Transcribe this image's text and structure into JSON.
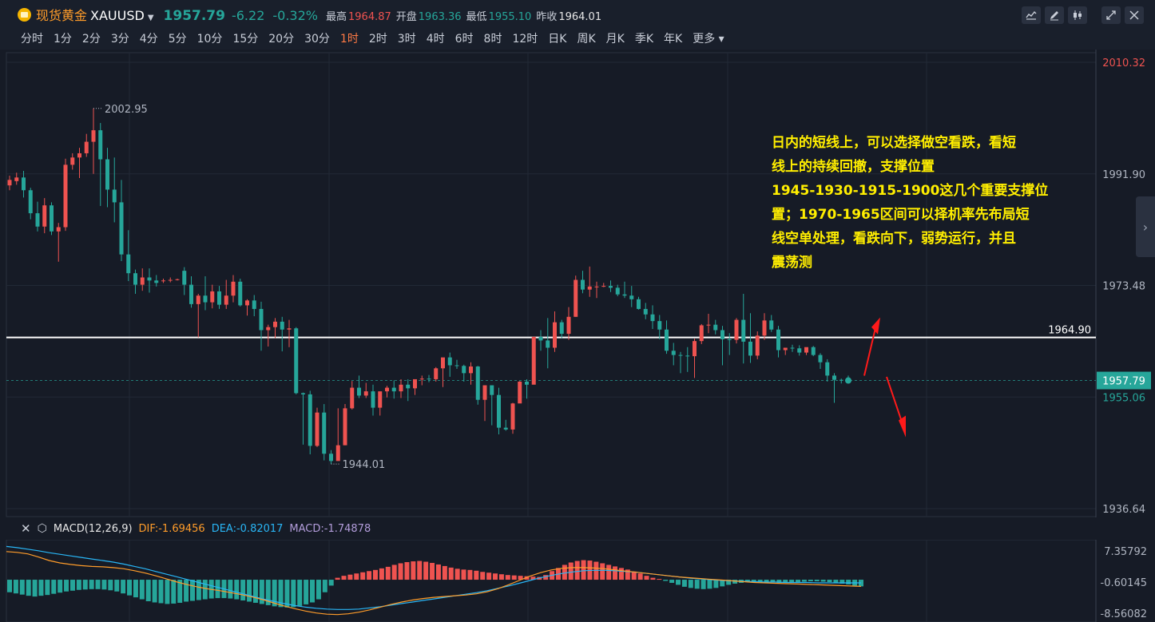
{
  "header": {
    "symbol_name": "现货黄金",
    "symbol_code": "XAUUSD",
    "price": "1957.79",
    "change": "-6.22",
    "change_pct": "-0.32%",
    "high_label": "最高",
    "high": "1964.87",
    "open_label": "开盘",
    "open": "1963.36",
    "low_label": "最低",
    "low": "1955.10",
    "prev_label": "昨收",
    "prev": "1964.01"
  },
  "timeframes": [
    "分时",
    "1分",
    "2分",
    "3分",
    "4分",
    "5分",
    "10分",
    "15分",
    "20分",
    "30分",
    "1时",
    "2时",
    "3时",
    "4时",
    "6时",
    "8时",
    "12时",
    "日K",
    "周K",
    "月K",
    "季K",
    "年K",
    "更多"
  ],
  "active_timeframe": "1时",
  "colors": {
    "up": "#ef5350",
    "down": "#26a69a",
    "annotation": "#ffee00",
    "dif": "#ff9c2a",
    "dea": "#29b6f6",
    "macd": "#b39ddb"
  },
  "annotation": {
    "lines": [
      "日内的短线上，可以选择做空看跌，看短",
      "线上的持续回撤，支撑位置",
      "1945-1930-1915-1900这几个重要支撑位",
      "置；1970-1965区间可以择机率先布局短",
      "线空单处理，看跌向下，弱势运行，并且",
      "震荡测"
    ]
  },
  "chart_data": [
    {
      "type": "candlestick",
      "title": "",
      "xlabel": "",
      "ylabel": "",
      "ylim": [
        1936.64,
        2010.32
      ],
      "y_ticks": [
        "2010.32",
        "1991.90",
        "1973.48",
        "1955.06",
        "1936.64"
      ],
      "hline": {
        "value": 1964.9,
        "label": "1964.90"
      },
      "last_price": {
        "value": 1957.79,
        "label": "1957.79"
      },
      "max_label": "2002.95",
      "min_label": "1944.01",
      "grid": true,
      "candles": [
        [
          1990.0,
          1991.6,
          1990.9,
          1989.2
        ],
        [
          1990.7,
          1992.1,
          1991.3,
          1990.1
        ],
        [
          1991.3,
          1992.4,
          1989.2,
          1988.0
        ],
        [
          1989.2,
          1989.6,
          1985.4,
          1984.4
        ],
        [
          1985.4,
          1987.3,
          1983.2,
          1982.4
        ],
        [
          1983.2,
          1987.9,
          1986.7,
          1982.1
        ],
        [
          1986.7,
          1987.2,
          1982.4,
          1981.8
        ],
        [
          1982.4,
          1983.8,
          1983.1,
          1977.4
        ],
        [
          1983.1,
          1994.4,
          1993.4,
          1982.5
        ],
        [
          1993.4,
          1995.3,
          1994.6,
          1992.6
        ],
        [
          1994.6,
          1996.2,
          1995.3,
          1991.2
        ],
        [
          1995.3,
          1998.5,
          1997.2,
          1994.7
        ],
        [
          1997.2,
          2002.7,
          1999.1,
          1991.9
        ],
        [
          1999.1,
          2000.3,
          1994.3,
          1986.6
        ],
        [
          1994.3,
          1996.2,
          1989.3,
          1986.4
        ],
        [
          1989.3,
          1994.6,
          1987.2,
          1983.9
        ],
        [
          1987.2,
          1990.9,
          1978.6,
          1977.5
        ],
        [
          1978.6,
          1982.6,
          1975.5,
          1974.2
        ],
        [
          1975.5,
          1976.1,
          1973.6,
          1972.1
        ],
        [
          1973.6,
          1976.3,
          1974.8,
          1972.6
        ],
        [
          1974.8,
          1976.3,
          1974.3,
          1972.3
        ],
        [
          1974.3,
          1975.2,
          1973.9,
          1973.3
        ],
        [
          1974.2,
          1974.6,
          1974.3,
          1973.9
        ],
        [
          1974.3,
          1974.8,
          1974.4,
          1974.0
        ],
        [
          1974.4,
          1974.6,
          1974.5,
          1974.3
        ],
        [
          1975.9,
          1976.5,
          1973.6,
          1971.9
        ],
        [
          1973.6,
          1975.0,
          1970.4,
          1969.8
        ],
        [
          1970.4,
          1972.1,
          1971.8,
          1964.9
        ],
        [
          1971.8,
          1975.0,
          1970.7,
          1969.4
        ],
        [
          1970.7,
          1973.6,
          1972.5,
          1969.7
        ],
        [
          1972.5,
          1973.4,
          1970.3,
          1969.6
        ],
        [
          1970.3,
          1974.4,
          1971.8,
          1969.6
        ],
        [
          1971.8,
          1975.2,
          1974.1,
          1970.7
        ],
        [
          1974.1,
          1974.6,
          1970.2,
          1970.0
        ],
        [
          1970.2,
          1971.2,
          1971.0,
          1968.5
        ],
        [
          1971.0,
          1971.9,
          1969.6,
          1968.4
        ],
        [
          1969.6,
          1970.8,
          1966.1,
          1962.7
        ],
        [
          1966.1,
          1967.0,
          1966.6,
          1963.4
        ],
        [
          1966.6,
          1968.1,
          1967.5,
          1964.8
        ],
        [
          1967.5,
          1968.3,
          1966.2,
          1962.6
        ],
        [
          1966.2,
          1967.8,
          1966.4,
          1963.3
        ],
        [
          1966.4,
          1966.6,
          1955.7,
          1955.5
        ],
        [
          1955.7,
          1955.8,
          1955.5,
          1947.2
        ],
        [
          1955.5,
          1956.1,
          1947.0,
          1945.6
        ],
        [
          1947.0,
          1953.3,
          1952.5,
          1946.8
        ],
        [
          1952.5,
          1953.9,
          1945.7,
          1944.6
        ],
        [
          1945.7,
          1946.3,
          1944.5,
          1944.0
        ],
        [
          1944.5,
          1953.2,
          1947.1,
          1947.0
        ],
        [
          1947.1,
          1953.9,
          1953.2,
          1947.1
        ],
        [
          1953.2,
          1957.7,
          1956.6,
          1953.0
        ],
        [
          1956.6,
          1958.6,
          1955.3,
          1954.9
        ],
        [
          1955.3,
          1957.4,
          1956.0,
          1954.9
        ],
        [
          1956.0,
          1957.1,
          1953.3,
          1952.0
        ],
        [
          1953.3,
          1955.3,
          1956.0,
          1952.0
        ],
        [
          1956.0,
          1956.9,
          1956.6,
          1955.0
        ],
        [
          1956.6,
          1957.8,
          1956.0,
          1954.8
        ],
        [
          1956.0,
          1958.0,
          1957.1,
          1954.9
        ],
        [
          1957.1,
          1958.0,
          1956.5,
          1954.4
        ],
        [
          1956.5,
          1956.8,
          1958.0,
          1955.4
        ],
        [
          1958.0,
          1958.6,
          1958.1,
          1957.0
        ],
        [
          1958.1,
          1958.7,
          1958.0,
          1957.5
        ],
        [
          1958.0,
          1960.0,
          1959.8,
          1957.6
        ],
        [
          1959.8,
          1960.6,
          1961.6,
          1956.7
        ],
        [
          1961.6,
          1962.4,
          1960.3,
          1958.4
        ],
        [
          1960.3,
          1961.2,
          1960.2,
          1959.7
        ],
        [
          1960.2,
          1960.4,
          1959.0,
          1957.6
        ],
        [
          1959.0,
          1960.8,
          1960.1,
          1957.1
        ],
        [
          1960.1,
          1960.2,
          1954.6,
          1953.8
        ],
        [
          1954.6,
          1956.5,
          1957.0,
          1951.1
        ],
        [
          1957.0,
          1957.0,
          1955.4,
          1950.4
        ],
        [
          1955.4,
          1956.6,
          1950.0,
          1948.9
        ],
        [
          1950.0,
          1951.3,
          1949.7,
          1949.5
        ],
        [
          1949.7,
          1954.1,
          1954.0,
          1949.0
        ],
        [
          1954.0,
          1957.7,
          1957.6,
          1954.5
        ],
        [
          1957.6,
          1958.0,
          1957.1,
          1954.8
        ],
        [
          1957.1,
          1964.8,
          1965.0,
          1958.4
        ],
        [
          1965.0,
          1966.1,
          1964.4,
          1962.7
        ],
        [
          1964.4,
          1968.1,
          1963.2,
          1959.8
        ],
        [
          1963.2,
          1969.2,
          1967.4,
          1962.5
        ],
        [
          1967.4,
          1967.8,
          1965.5,
          1964.8
        ],
        [
          1965.5,
          1969.9,
          1968.3,
          1964.5
        ],
        [
          1968.3,
          1975.1,
          1974.4,
          1968.3
        ],
        [
          1974.4,
          1975.9,
          1972.8,
          1972.2
        ],
        [
          1972.8,
          1976.6,
          1973.3,
          1971.6
        ],
        [
          1973.3,
          1974.1,
          1973.3,
          1971.4
        ],
        [
          1973.3,
          1973.9,
          1973.4,
          1973.2
        ],
        [
          1973.4,
          1974.3,
          1973.1,
          1972.4
        ],
        [
          1973.1,
          1973.6,
          1972.0,
          1971.7
        ],
        [
          1972.0,
          1974.1,
          1971.8,
          1971.4
        ],
        [
          1971.8,
          1973.4,
          1971.2,
          1969.9
        ],
        [
          1971.2,
          1971.6,
          1969.6,
          1969.5
        ],
        [
          1969.6,
          1970.6,
          1968.7,
          1967.9
        ],
        [
          1968.7,
          1970.2,
          1967.6,
          1966.3
        ],
        [
          1967.6,
          1968.6,
          1966.2,
          1964.6
        ],
        [
          1966.2,
          1967.7,
          1962.7,
          1962.2
        ],
        [
          1962.7,
          1964.0,
          1962.0,
          1960.3
        ],
        [
          1962.0,
          1962.5,
          1961.9,
          1959.0
        ],
        [
          1961.9,
          1963.3,
          1961.8,
          1959.2
        ],
        [
          1961.8,
          1964.7,
          1964.3,
          1958.2
        ],
        [
          1964.3,
          1967.1,
          1966.9,
          1963.8
        ],
        [
          1966.9,
          1968.8,
          1967.0,
          1965.6
        ],
        [
          1967.0,
          1967.8,
          1966.1,
          1965.4
        ],
        [
          1966.1,
          1966.8,
          1964.6,
          1960.3
        ],
        [
          1964.6,
          1965.6,
          1964.5,
          1962.0
        ],
        [
          1964.5,
          1968.1,
          1967.8,
          1963.9
        ],
        [
          1967.8,
          1972.1,
          1964.2,
          1960.6
        ],
        [
          1964.2,
          1968.9,
          1961.9,
          1960.7
        ],
        [
          1961.9,
          1965.9,
          1965.2,
          1961.3
        ],
        [
          1965.2,
          1968.9,
          1967.7,
          1964.5
        ],
        [
          1967.7,
          1968.6,
          1966.2,
          1965.8
        ],
        [
          1966.2,
          1966.8,
          1962.8,
          1961.6
        ],
        [
          1962.8,
          1963.1,
          1963.2,
          1962.0
        ],
        [
          1963.2,
          1963.7,
          1963.1,
          1962.5
        ],
        [
          1963.1,
          1963.6,
          1962.4,
          1961.9
        ],
        [
          1962.4,
          1963.0,
          1963.3,
          1962.0
        ],
        [
          1963.3,
          1963.5,
          1962.0,
          1961.8
        ],
        [
          1962.0,
          1962.3,
          1960.8,
          1959.7
        ],
        [
          1960.8,
          1961.3,
          1958.6,
          1957.6
        ],
        [
          1958.6,
          1959.0,
          1957.9,
          1954.1
        ],
        [
          1957.9,
          1958.1,
          1957.8,
          1957.3
        ],
        [
          1957.8,
          1958.6,
          1957.7,
          1957.4
        ]
      ]
    },
    {
      "type": "macd",
      "indicator_label": "MACD(12,26,9)",
      "dif_label": "DIF:-1.69456",
      "dea_label": "DEA:-0.82017",
      "macd_label": "MACD:-1.74878",
      "ylim": [
        -10.0,
        10.0
      ],
      "y_ticks": [
        "7.35792",
        "-0.60145",
        "-8.56082"
      ],
      "hist": [
        -3.2,
        -3.5,
        -3.8,
        -4.1,
        -4.3,
        -4.1,
        -3.9,
        -3.6,
        -3.3,
        -3.0,
        -2.8,
        -2.6,
        -2.5,
        -2.4,
        -2.4,
        -2.5,
        -2.7,
        -3.0,
        -3.5,
        -4.0,
        -4.5,
        -5.0,
        -5.5,
        -5.8,
        -6.0,
        -6.2,
        -6.1,
        -5.9,
        -5.6,
        -5.4,
        -5.2,
        -5.0,
        -4.8,
        -4.7,
        -4.7,
        -4.8,
        -5.0,
        -5.3,
        -5.6,
        -5.9,
        -6.2,
        -6.5,
        -6.8,
        -7.0,
        -7.1,
        -7.0,
        -6.7,
        -6.3,
        -5.8,
        -5.0,
        -3.2,
        -1.5,
        0.5,
        1.0,
        1.3,
        1.6,
        1.9,
        2.2,
        2.5,
        2.9,
        3.3,
        3.8,
        4.2,
        4.5,
        4.7,
        4.8,
        4.6,
        4.3,
        3.9,
        3.5,
        3.1,
        2.8,
        2.6,
        2.5,
        2.3,
        2.0,
        1.8,
        1.6,
        1.4,
        1.2,
        1.1,
        1.0,
        0.9,
        0.8,
        0.7,
        1.2,
        2.2,
        3.0,
        3.8,
        4.4,
        4.8,
        5.0,
        4.9,
        4.6,
        4.2,
        3.8,
        3.4,
        3.0,
        2.6,
        2.1,
        1.6,
        1.0,
        0.5,
        0.2,
        -0.3,
        -0.8,
        -1.3,
        -1.8,
        -2.1,
        -2.3,
        -2.4,
        -2.3,
        -2.1,
        -1.7,
        -1.3,
        -1.0,
        -0.8,
        -0.6,
        -0.5,
        -0.5,
        -0.6,
        -0.7,
        -0.8,
        -0.7,
        -0.6,
        -0.6,
        -0.5,
        -0.4,
        -0.4,
        -0.5,
        -0.6,
        -0.8,
        -1.0,
        -1.2,
        -1.5,
        -1.7
      ],
      "dif": [
        7.2,
        7.0,
        6.6,
        5.8,
        4.9,
        4.3,
        3.9,
        3.6,
        3.4,
        3.3,
        3.1,
        2.8,
        2.3,
        1.7,
        1.0,
        0.2,
        -0.6,
        -1.3,
        -1.9,
        -2.4,
        -2.8,
        -3.3,
        -3.8,
        -4.4,
        -5.1,
        -5.9,
        -6.7,
        -7.4,
        -8.0,
        -8.5,
        -8.8,
        -8.9,
        -8.7,
        -8.3,
        -7.7,
        -7.0,
        -6.3,
        -5.7,
        -5.2,
        -4.8,
        -4.5,
        -4.3,
        -4.1,
        -3.9,
        -3.6,
        -3.1,
        -2.3,
        -1.3,
        -0.2,
        0.9,
        1.8,
        2.5,
        2.9,
        3.1,
        3.1,
        3.0,
        2.8,
        2.5,
        2.2,
        1.9,
        1.6,
        1.3,
        1.0,
        0.7,
        0.5,
        0.3,
        0.1,
        -0.1,
        -0.3,
        -0.5,
        -0.7,
        -0.8,
        -0.9,
        -1.0,
        -1.1,
        -1.2,
        -1.3,
        -1.4,
        -1.5,
        -1.6,
        -1.7
      ],
      "dea": [
        8.5,
        8.2,
        7.8,
        7.4,
        6.9,
        6.5,
        6.1,
        5.7,
        5.3,
        4.9,
        4.5,
        4.0,
        3.4,
        2.8,
        2.1,
        1.4,
        0.7,
        0.0,
        -0.7,
        -1.4,
        -2.1,
        -2.8,
        -3.5,
        -4.2,
        -4.9,
        -5.5,
        -6.1,
        -6.6,
        -7.0,
        -7.3,
        -7.5,
        -7.6,
        -7.6,
        -7.5,
        -7.2,
        -6.9,
        -6.5,
        -6.1,
        -5.7,
        -5.3,
        -4.9,
        -4.5,
        -4.1,
        -3.7,
        -3.3,
        -2.8,
        -2.2,
        -1.6,
        -0.9,
        -0.2,
        0.5,
        1.1,
        1.6,
        2.0,
        2.3,
        2.4,
        2.4,
        2.3,
        2.1,
        1.9,
        1.6,
        1.3,
        1.0,
        0.7,
        0.4,
        0.2,
        0.0,
        -0.2,
        -0.3,
        -0.4,
        -0.5,
        -0.6,
        -0.6,
        -0.7,
        -0.7,
        -0.7,
        -0.8,
        -0.8,
        -0.8,
        -0.8,
        -0.8
      ]
    }
  ]
}
